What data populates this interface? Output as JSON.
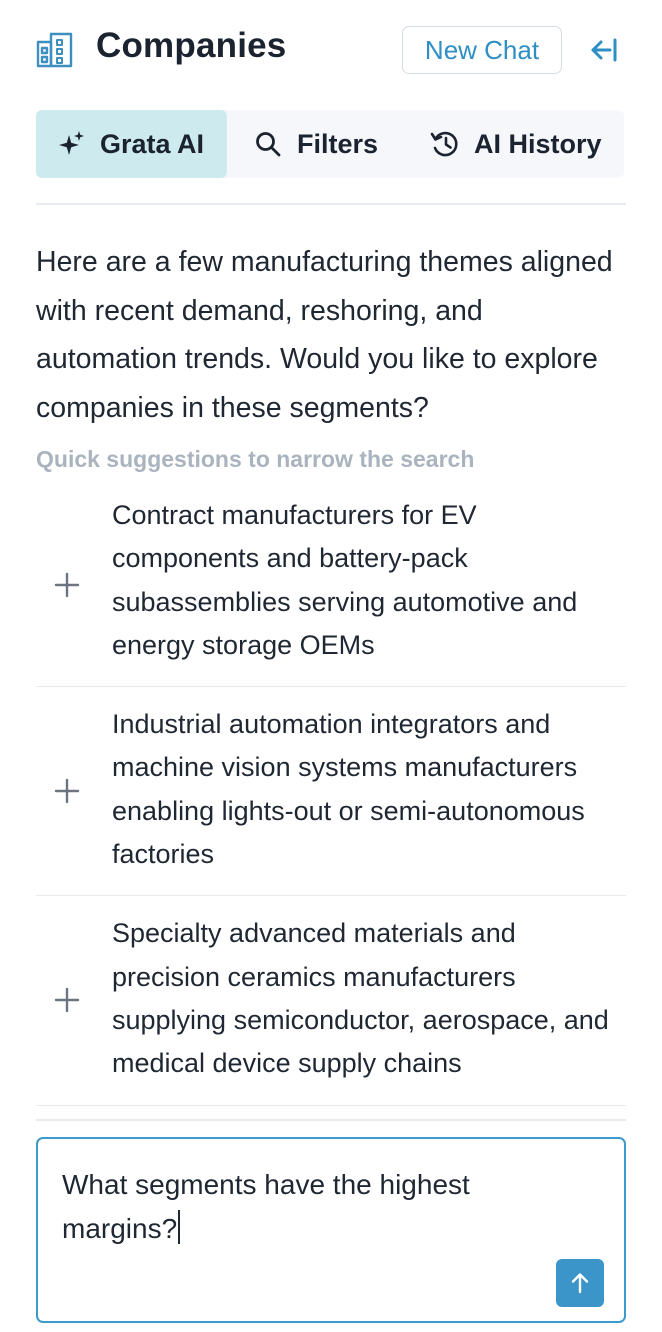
{
  "header": {
    "title": "Companies",
    "new_chat_label": "New Chat",
    "app_icon": "buildings-icon",
    "collapse_icon": "collapse-left-icon"
  },
  "tabs": [
    {
      "label": "Grata AI",
      "icon": "sparkle-icon",
      "active": true
    },
    {
      "label": "Filters",
      "icon": "search-icon",
      "active": false
    },
    {
      "label": "AI History",
      "icon": "history-icon",
      "active": false
    }
  ],
  "chat": {
    "message": "Here are a few manufacturing themes aligned with recent demand, reshoring, and automation trends. Would you like to explore companies in these segments?",
    "suggestions_hint": "Quick suggestions to narrow the search",
    "suggestions": [
      {
        "text": "Contract manufacturers for EV components and battery-pack subassemblies serving automotive and energy storage OEMs"
      },
      {
        "text": "Industrial automation integrators and machine vision systems manufacturers enabling lights-out or semi-autonomous factories"
      },
      {
        "text": "Specialty advanced materials and precision ceramics manufacturers supplying semiconductor, aerospace, and medical device supply chains"
      }
    ]
  },
  "composer": {
    "value": "What segments have the highest margins?",
    "send_icon": "arrow-up-icon"
  },
  "colors": {
    "accent": "#2e8fc4",
    "active_tab_bg": "#cdebee",
    "send_button": "#3b95c8",
    "composer_border": "#3e9acb"
  }
}
